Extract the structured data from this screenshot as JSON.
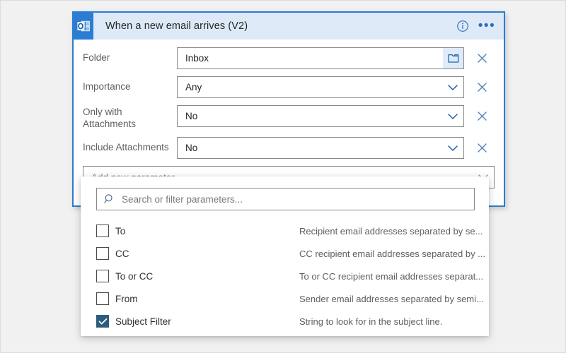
{
  "card": {
    "title": "When a new email arrives (V2)",
    "app_icon": "outlook-icon",
    "info_icon": "info-circle-icon",
    "more_icon": "ellipsis-icon",
    "more_glyph": "•••"
  },
  "fields": [
    {
      "label": "Folder",
      "value": "Inbox",
      "control": "folder-picker",
      "trailing_icon": "folder-icon",
      "clear_icon": "close-icon",
      "two_line": false
    },
    {
      "label": "Importance",
      "value": "Any",
      "control": "dropdown",
      "trailing_icon": "chevron-down-icon",
      "clear_icon": "close-icon",
      "two_line": false
    },
    {
      "label": "Only with Attachments",
      "value": "No",
      "control": "dropdown",
      "trailing_icon": "chevron-down-icon",
      "clear_icon": "close-icon",
      "two_line": true
    },
    {
      "label": "Include Attachments",
      "value": "No",
      "control": "dropdown",
      "trailing_icon": "chevron-down-icon",
      "clear_icon": "close-icon",
      "two_line": false
    }
  ],
  "add_parameter": {
    "placeholder": "Add new parameter",
    "chevron_icon": "chevron-down-icon"
  },
  "dropdown": {
    "search_placeholder": "Search or filter parameters...",
    "search_icon": "search-icon",
    "options": [
      {
        "label": "To",
        "description": "Recipient email addresses separated by se...",
        "checked": false
      },
      {
        "label": "CC",
        "description": "CC recipient email addresses separated by ...",
        "checked": false
      },
      {
        "label": "To or CC",
        "description": "To or CC recipient email addresses separat...",
        "checked": false
      },
      {
        "label": "From",
        "description": "Sender email addresses separated by semi...",
        "checked": false
      },
      {
        "label": "Subject Filter",
        "description": "String to look for in the subject line.",
        "checked": true
      }
    ]
  },
  "colors": {
    "accent_blue": "#2b7cd3",
    "header_blue": "#dde9f7",
    "checked_box": "#2c5d7c",
    "page_bg": "#f1f1f1"
  }
}
